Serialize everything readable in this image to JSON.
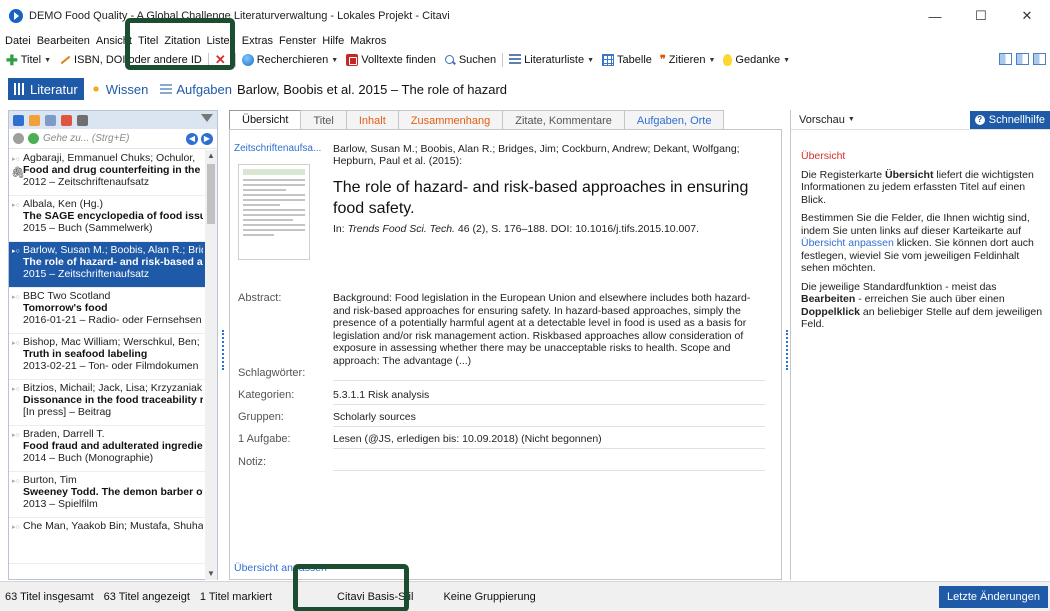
{
  "window": {
    "title": "DEMO Food Quality - A Global Challenge Literaturverwaltung - Lokales Projekt - Citavi",
    "controls": {
      "minimize": "—",
      "maximize": "☐",
      "close": "✕"
    }
  },
  "menu": [
    "Datei",
    "Bearbeiten",
    "Ansicht",
    "Titel",
    "Zitation",
    "Listen",
    "Extras",
    "Fenster",
    "Hilfe",
    "Makros"
  ],
  "toolbar": {
    "titel": "Titel",
    "isbn": "ISBN, DOI oder andere ID",
    "recherchieren": "Recherchieren",
    "volltexte": "Volltexte finden",
    "suchen": "Suchen",
    "literaturliste": "Literaturliste",
    "tabelle": "Tabelle",
    "zitieren": "Zitieren",
    "gedanke": "Gedanke"
  },
  "nav": {
    "literatur": "Literatur",
    "wissen": "Wissen",
    "aufgaben": "Aufgaben"
  },
  "ref_header": "Barlow, Boobis et al. 2015 – The role of hazard",
  "left": {
    "search_placeholder": "Gehe zu... (Strg+E)",
    "items": [
      {
        "author": "Agbaraji, Emmanuel Chuks; Ochulor,",
        "title": "Food and drug counterfeiting in the",
        "meta": "2012 – Zeitschriftenaufsatz"
      },
      {
        "author": "Albala, Ken (Hg.)",
        "title": "The SAGE encyclopedia of food issue",
        "meta": "2015 – Buch (Sammelwerk)"
      },
      {
        "author": "Barlow, Susan M.; Boobis, Alan R.; Brid",
        "title": "The role of hazard- and risk-based ap",
        "meta": "2015 – Zeitschriftenaufsatz"
      },
      {
        "author": "BBC Two Scotland",
        "title": "Tomorrow's food",
        "meta": "2016-01-21 – Radio- oder Fernsehsen"
      },
      {
        "author": "Bishop, Mac William; Werschkul, Ben;",
        "title": "Truth in seafood labeling",
        "meta": "2013-02-21 – Ton- oder Filmdokumen"
      },
      {
        "author": "Bitzios, Michail; Jack, Lisa; Krzyzaniak,",
        "title": "Dissonance in the food traceability re",
        "meta": "[In press] – Beitrag"
      },
      {
        "author": "Braden, Darrell T.",
        "title": "Food fraud and adulterated ingredie",
        "meta": "2014 – Buch (Monographie)"
      },
      {
        "author": "Burton, Tim",
        "title": "Sweeney Todd. The demon barber of",
        "meta": "2013 – Spielfilm"
      },
      {
        "author": "Che Man, Yaakob Bin; Mustafa, Shuha",
        "title": "",
        "meta": ""
      }
    ]
  },
  "tabs": [
    "Übersicht",
    "Titel",
    "Inhalt",
    "Zusammenhang",
    "Zitate, Kommentare",
    "Aufgaben, Orte"
  ],
  "detail": {
    "doc_type": "Zeitschriftenaufsa...",
    "authors": "Barlow, Susan M.; Boobis, Alan R.; Bridges, Jim; Cockburn, Andrew; Dekant, Wolfgang; Hepburn, Paul et al. (2015):",
    "title": "The role of hazard- and risk-based approaches in ensuring food safety.",
    "source_prefix": "In: ",
    "source_journal": "Trends Food Sci. Tech.",
    "source_rest": " 46 (2), S. 176–188. DOI: 10.1016/j.tifs.2015.10.007.",
    "abstract_label": "Abstract:",
    "abstract": "Background: Food legislation in the European Union and elsewhere includes both hazard- and risk-based approaches for ensuring safety. In hazard-based approaches, simply the presence of a potentially harmful agent at a detectable level in food is used as a basis for legislation and/or risk management action. Riskbased approaches allow consideration of exposure in assessing whether there may be unacceptable risks to health. Scope and approach: The advantage (...)",
    "schlagwoerter_label": "Schlagwörter:",
    "kategorien_label": "Kategorien:",
    "kategorien": "5.3.1.1 Risk analysis",
    "gruppen_label": "Gruppen:",
    "gruppen": "Scholarly sources",
    "aufgabe_label": "1 Aufgabe:",
    "aufgabe": "Lesen (@JS, erledigen bis: 10.09.2018) (Nicht begonnen)",
    "notiz_label": "Notiz:",
    "overview_link": "Übersicht anpassen"
  },
  "right": {
    "preview": "Vorschau",
    "help": "Schnellhilfe",
    "heading": "Übersicht",
    "p1_a": "Die Registerkarte ",
    "p1_b": "Übersicht",
    "p1_c": " liefert die wichtigsten Informationen zu jedem erfassten Titel auf einen Blick.",
    "p2_a": "Bestimmen Sie die Felder, die Ihnen wichtig sind, indem Sie unten links auf dieser Karteikarte auf ",
    "p2_link": "Übersicht anpassen",
    "p2_b": " klicken. Sie können dort auch festlegen, wieviel Sie vom jeweiligen Feldinhalt sehen möchten.",
    "p3_a": "Die jeweilige Standardfunktion - meist das ",
    "p3_b": "Bearbeiten",
    "p3_c": " - erreichen Sie auch über einen ",
    "p3_d": "Doppelklick",
    "p3_e": " an beliebiger Stelle auf dem jeweiligen Feld."
  },
  "status": {
    "total": "63 Titel insgesamt",
    "shown": "63 Titel angezeigt",
    "marked": "1 Titel markiert",
    "style": "Citavi Basis-Stil",
    "group": "Keine Gruppierung",
    "changes": "Letzte Änderungen"
  },
  "colors": {
    "accent": "#1f5aa8",
    "highlight_frame": "#1b4e30",
    "tab_orange": "#e35d13"
  }
}
